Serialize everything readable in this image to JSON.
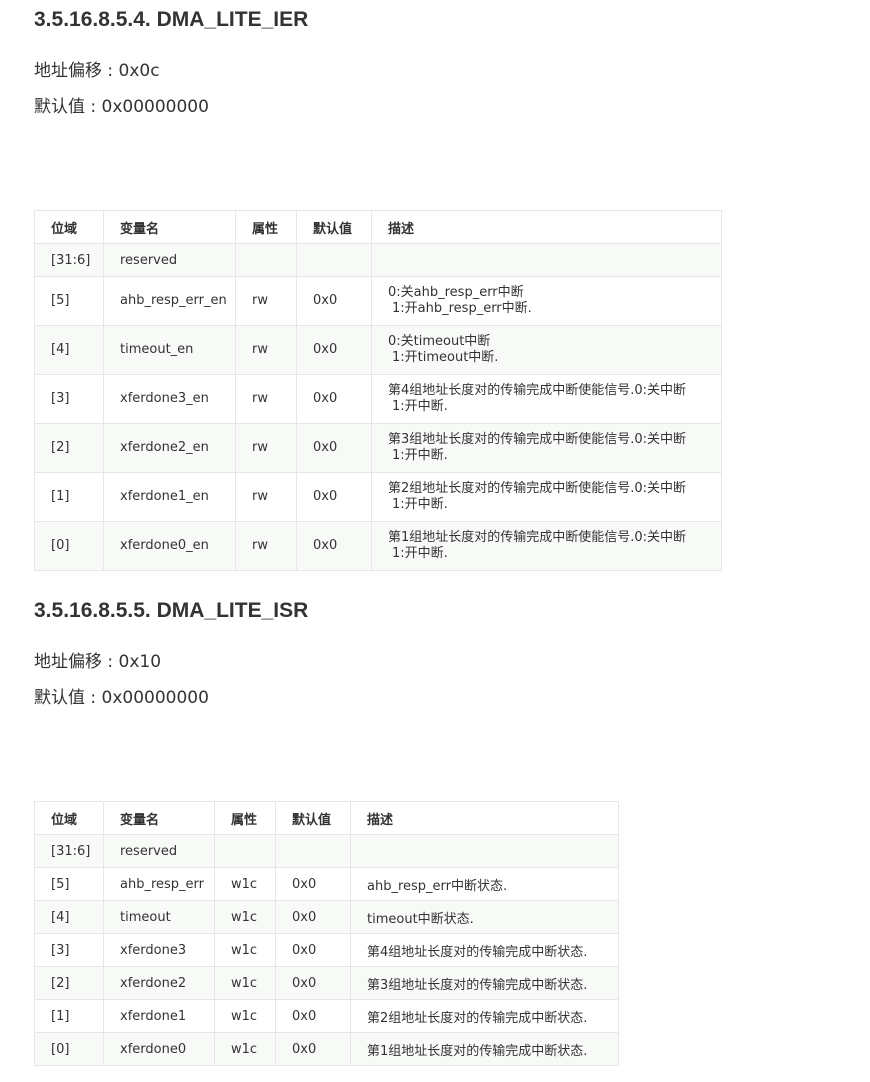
{
  "sections": [
    {
      "title": "3.5.16.8.5.4. DMA_LITE_IER",
      "offset": "地址偏移 : 0x0c",
      "default": "默认值 : 0x00000000",
      "headers": [
        "位域",
        "变量名",
        "属性",
        "默认值",
        "描述"
      ],
      "rows": [
        {
          "bits": "[31:6]",
          "name": "reserved",
          "attr": "",
          "def": "",
          "d1": "",
          "d2": ""
        },
        {
          "bits": "[5]",
          "name": "ahb_resp_err_en",
          "attr": "rw",
          "def": "0x0",
          "d1": "0:关ahb_resp_err中断",
          "d2": "1:开ahb_resp_err中断."
        },
        {
          "bits": "[4]",
          "name": "timeout_en",
          "attr": "rw",
          "def": "0x0",
          "d1": "0:关timeout中断",
          "d2": "1:开timeout中断."
        },
        {
          "bits": "[3]",
          "name": "xferdone3_en",
          "attr": "rw",
          "def": "0x0",
          "d1": "第4组地址长度对的传输完成中断使能信号.0:关中断",
          "d2": "1:开中断."
        },
        {
          "bits": "[2]",
          "name": "xferdone2_en",
          "attr": "rw",
          "def": "0x0",
          "d1": "第3组地址长度对的传输完成中断使能信号.0:关中断",
          "d2": "1:开中断."
        },
        {
          "bits": "[1]",
          "name": "xferdone1_en",
          "attr": "rw",
          "def": "0x0",
          "d1": "第2组地址长度对的传输完成中断使能信号.0:关中断",
          "d2": "1:开中断."
        },
        {
          "bits": "[0]",
          "name": "xferdone0_en",
          "attr": "rw",
          "def": "0x0",
          "d1": "第1组地址长度对的传输完成中断使能信号.0:关中断",
          "d2": "1:开中断."
        }
      ]
    },
    {
      "title": "3.5.16.8.5.5. DMA_LITE_ISR",
      "offset": "地址偏移 : 0x10",
      "default": "默认值 : 0x00000000",
      "headers": [
        "位域",
        "变量名",
        "属性",
        "默认值",
        "描述"
      ],
      "rows": [
        {
          "bits": "[31:6]",
          "name": "reserved",
          "attr": "",
          "def": "",
          "desc": ""
        },
        {
          "bits": "[5]",
          "name": "ahb_resp_err",
          "attr": "w1c",
          "def": "0x0",
          "desc": "ahb_resp_err中断状态."
        },
        {
          "bits": "[4]",
          "name": "timeout",
          "attr": "w1c",
          "def": "0x0",
          "desc": "timeout中断状态."
        },
        {
          "bits": "[3]",
          "name": "xferdone3",
          "attr": "w1c",
          "def": "0x0",
          "desc": "第4组地址长度对的传输完成中断状态."
        },
        {
          "bits": "[2]",
          "name": "xferdone2",
          "attr": "w1c",
          "def": "0x0",
          "desc": "第3组地址长度对的传输完成中断状态."
        },
        {
          "bits": "[1]",
          "name": "xferdone1",
          "attr": "w1c",
          "def": "0x0",
          "desc": "第2组地址长度对的传输完成中断状态."
        },
        {
          "bits": "[0]",
          "name": "xferdone0",
          "attr": "w1c",
          "def": "0x0",
          "desc": "第1组地址长度对的传输完成中断状态."
        }
      ]
    }
  ]
}
